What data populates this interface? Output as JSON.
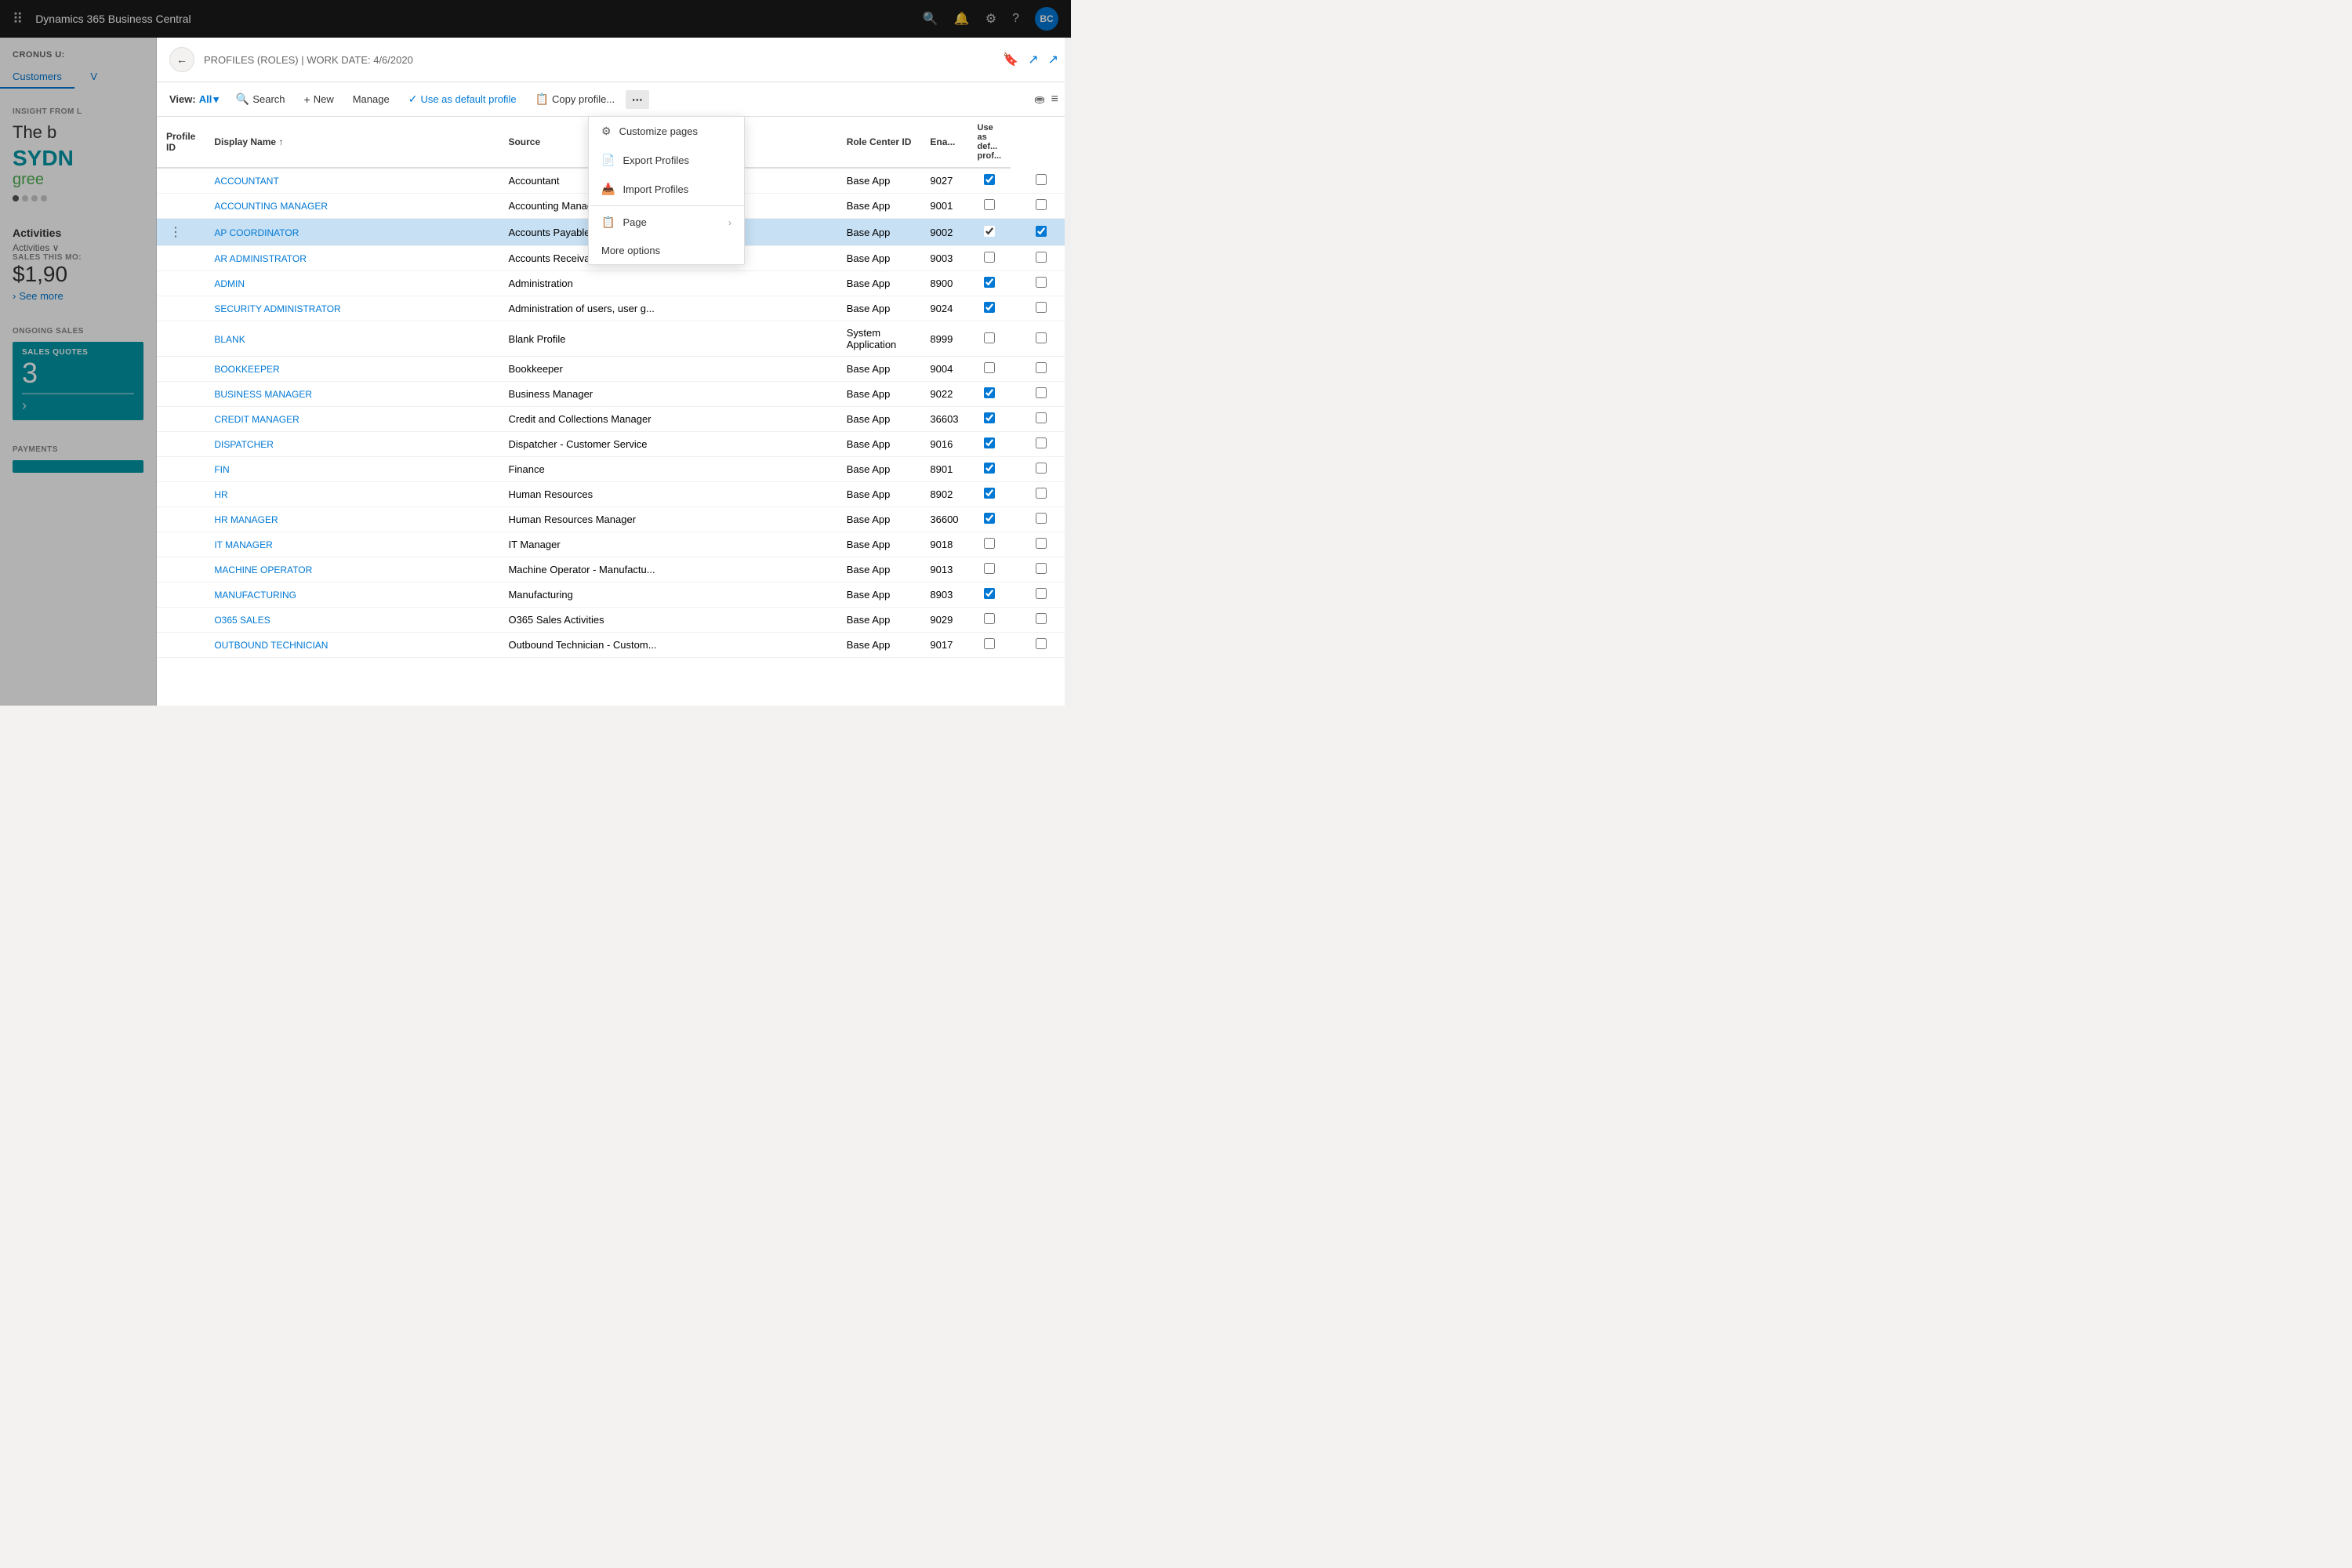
{
  "app": {
    "title": "Dynamics 365 Business Central",
    "avatar": "BC"
  },
  "sidebar": {
    "company": "CRONUS U:",
    "nav_items": [
      "Customers",
      "V"
    ],
    "insight": {
      "label": "INSIGHT FROM L",
      "headline": "The b",
      "city": "SYDN",
      "subtext": "gree"
    },
    "activities": {
      "title": "Activities",
      "subtitle": "Activities",
      "sales_label": "SALES THIS MO:",
      "sales_amount": "$1,90",
      "see_more": "See more"
    },
    "ongoing_sales": {
      "label": "ONGOING SALES",
      "card_label": "SALES QUOTES",
      "card_number": "3"
    },
    "payments": {
      "label": "PAYMENTS"
    }
  },
  "modal": {
    "title": "PROFILES (ROLES) | WORK DATE: 4/6/2020",
    "toolbar": {
      "view_label": "View:",
      "view_value": "All",
      "search_label": "Search",
      "new_label": "New",
      "manage_label": "Manage",
      "default_profile_label": "Use as default profile",
      "copy_profile_label": "Copy profile..."
    },
    "table": {
      "columns": [
        {
          "key": "profile_id",
          "label": "Profile ID",
          "sortable": true
        },
        {
          "key": "display_name",
          "label": "Display Name",
          "sortable": true,
          "sort_dir": "asc"
        },
        {
          "key": "source",
          "label": "Source"
        },
        {
          "key": "role_center_id",
          "label": "Role Center ID"
        },
        {
          "key": "enabled",
          "label": "Ena..."
        },
        {
          "key": "use_as_default",
          "label": "Use as def... prof..."
        }
      ],
      "rows": [
        {
          "profile_id": "ACCOUNTANT",
          "display_name": "Accountant",
          "source": "Base App",
          "role_center_id": "9027",
          "enabled": true,
          "use_as_default": false,
          "selected": false
        },
        {
          "profile_id": "ACCOUNTING MANAGER",
          "display_name": "Accounting Manager",
          "source": "Base App",
          "role_center_id": "9001",
          "enabled": false,
          "use_as_default": false,
          "selected": false
        },
        {
          "profile_id": "AP COORDINATOR",
          "display_name": "Accounts Payable Coordinator",
          "source": "Base App",
          "role_center_id": "9002",
          "enabled": true,
          "use_as_default": true,
          "selected": true
        },
        {
          "profile_id": "AR ADMINISTRATOR",
          "display_name": "Accounts Receivable Administr...",
          "source": "Base Application",
          "role_center_id": "9003",
          "enabled": false,
          "use_as_default": false,
          "selected": false
        },
        {
          "profile_id": "ADMIN",
          "display_name": "Administration",
          "source": "Base Application",
          "role_center_id": "8900",
          "enabled": true,
          "use_as_default": false,
          "selected": false
        },
        {
          "profile_id": "SECURITY ADMINISTRATOR",
          "display_name": "Administration of users, user g...",
          "source": "Base Application",
          "role_center_id": "9024",
          "enabled": true,
          "use_as_default": false,
          "selected": false
        },
        {
          "profile_id": "BLANK",
          "display_name": "Blank Profile",
          "source": "System Application",
          "role_center_id": "8999",
          "enabled": false,
          "use_as_default": false,
          "selected": false
        },
        {
          "profile_id": "BOOKKEEPER",
          "display_name": "Bookkeeper",
          "source": "Base Application",
          "role_center_id": "9004",
          "enabled": false,
          "use_as_default": false,
          "selected": false
        },
        {
          "profile_id": "BUSINESS MANAGER",
          "display_name": "Business Manager",
          "source": "Base Application",
          "role_center_id": "9022",
          "enabled": true,
          "use_as_default": false,
          "selected": false
        },
        {
          "profile_id": "CREDIT MANAGER",
          "display_name": "Credit and Collections Manager",
          "source": "Base Application",
          "role_center_id": "36603",
          "enabled": true,
          "use_as_default": false,
          "selected": false
        },
        {
          "profile_id": "DISPATCHER",
          "display_name": "Dispatcher - Customer Service",
          "source": "Base Application",
          "role_center_id": "9016",
          "enabled": true,
          "use_as_default": false,
          "selected": false
        },
        {
          "profile_id": "FIN",
          "display_name": "Finance",
          "source": "Base Application",
          "role_center_id": "8901",
          "enabled": true,
          "use_as_default": false,
          "selected": false
        },
        {
          "profile_id": "HR",
          "display_name": "Human Resources",
          "source": "Base Application",
          "role_center_id": "8902",
          "enabled": true,
          "use_as_default": false,
          "selected": false
        },
        {
          "profile_id": "HR MANAGER",
          "display_name": "Human Resources Manager",
          "source": "Base Application",
          "role_center_id": "36600",
          "enabled": true,
          "use_as_default": false,
          "selected": false
        },
        {
          "profile_id": "IT MANAGER",
          "display_name": "IT Manager",
          "source": "Base Application",
          "role_center_id": "9018",
          "enabled": false,
          "use_as_default": false,
          "selected": false
        },
        {
          "profile_id": "MACHINE OPERATOR",
          "display_name": "Machine Operator - Manufactu...",
          "source": "Base Application",
          "role_center_id": "9013",
          "enabled": false,
          "use_as_default": false,
          "selected": false
        },
        {
          "profile_id": "MANUFACTURING",
          "display_name": "Manufacturing",
          "source": "Base Application",
          "role_center_id": "8903",
          "enabled": true,
          "use_as_default": false,
          "selected": false
        },
        {
          "profile_id": "O365 SALES",
          "display_name": "O365 Sales Activities",
          "source": "Base Application",
          "role_center_id": "9029",
          "enabled": false,
          "use_as_default": false,
          "selected": false
        },
        {
          "profile_id": "OUTBOUND TECHNICIAN",
          "display_name": "Outbound Technician - Custom...",
          "source": "Base Application",
          "role_center_id": "9017",
          "enabled": false,
          "use_as_default": false,
          "selected": false
        }
      ]
    }
  },
  "dropdown": {
    "items": [
      {
        "icon": "⚙",
        "label": "Customize pages",
        "has_arrow": false
      },
      {
        "icon": "📄",
        "label": "Export Profiles",
        "has_arrow": false
      },
      {
        "icon": "📥",
        "label": "Import Profiles",
        "has_arrow": false
      },
      {
        "icon": "📋",
        "label": "Page",
        "has_arrow": true
      },
      {
        "icon": "",
        "label": "More options",
        "has_arrow": false
      }
    ]
  }
}
